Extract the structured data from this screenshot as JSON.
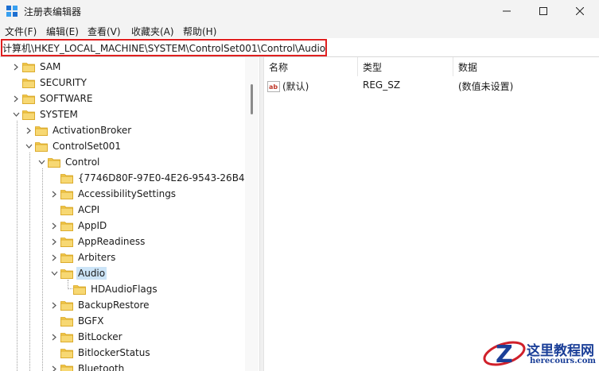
{
  "window": {
    "title": "注册表编辑器",
    "icon": "regedit-icon",
    "controls": [
      "minimize-icon",
      "maximize-icon",
      "close-icon"
    ]
  },
  "menu": [
    "文件(F)",
    "编辑(E)",
    "查看(V)",
    "收藏夹(A)",
    "帮助(H)"
  ],
  "address": {
    "path": "计算机\\HKEY_LOCAL_MACHINE\\SYSTEM\\ControlSet001\\Control\\Audio",
    "highlight_color": "#e02020"
  },
  "tree": [
    {
      "label": "SAM",
      "expander": "collapsed"
    },
    {
      "label": "SECURITY",
      "expander": "none"
    },
    {
      "label": "SOFTWARE",
      "expander": "collapsed"
    },
    {
      "label": "SYSTEM",
      "expander": "expanded"
    },
    {
      "label": "ActivationBroker",
      "expander": "collapsed"
    },
    {
      "label": "ControlSet001",
      "expander": "expanded"
    },
    {
      "label": "Control",
      "expander": "expanded"
    },
    {
      "label": "{7746D80F-97E0-4E26-9543-26B4",
      "expander": "none"
    },
    {
      "label": "AccessibilitySettings",
      "expander": "collapsed"
    },
    {
      "label": "ACPI",
      "expander": "none"
    },
    {
      "label": "AppID",
      "expander": "collapsed"
    },
    {
      "label": "AppReadiness",
      "expander": "collapsed"
    },
    {
      "label": "Arbiters",
      "expander": "collapsed"
    },
    {
      "label": "Audio",
      "expander": "expanded",
      "selected": true
    },
    {
      "label": "HDAudioFlags",
      "expander": "none"
    },
    {
      "label": "BackupRestore",
      "expander": "collapsed"
    },
    {
      "label": "BGFX",
      "expander": "none"
    },
    {
      "label": "BitLocker",
      "expander": "collapsed"
    },
    {
      "label": "BitlockerStatus",
      "expander": "none"
    },
    {
      "label": "Bluetooth",
      "expander": "collapsed"
    }
  ],
  "list": {
    "columns": [
      "名称",
      "类型",
      "数据"
    ],
    "rows": [
      {
        "name": "(默认)",
        "type": "REG_SZ",
        "data": "(数值未设置)",
        "icon": "string-value-icon"
      }
    ]
  },
  "colors": {
    "selection": "#cce4f7",
    "folder": "#f2c94c",
    "chrome": "#f3f3f3"
  },
  "watermark": {
    "title": "这里教程网",
    "url": "herecours.com"
  }
}
